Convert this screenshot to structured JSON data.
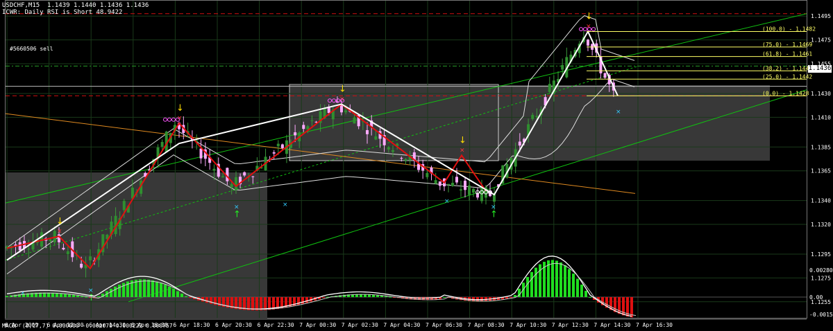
{
  "header": {
    "symbol_line": "USDCHF,M15  1.1439 1.1440 1.1436 1.1436",
    "indicator_line": "ICWR: Daily RSI is Short 48.9422",
    "order_label": "#5660506 sell",
    "current_price": "1.1436"
  },
  "macd": {
    "label": "MACD  (8,17,7) 0.000000 -0.001070 0.000222 0.000757"
  },
  "colors": {
    "background": "#000000",
    "grid": "#1a3a1a",
    "axis": "#ffffff",
    "wave_red": "#e01010",
    "wave_white": "#ffffff",
    "channel_green": "#10c010",
    "fib_yellow": "#ffff66",
    "resistance_red": "#d01010",
    "support_green": "#2aa02a",
    "bull_candle": "#2f8f2f",
    "bear_candle": "#ffaaff",
    "macd_pos": "#20dd20",
    "macd_neg": "#dd1010",
    "zone_fill": "#3a3a3a"
  },
  "chart_data": {
    "type": "candlestick",
    "symbol": "USDCHF",
    "timeframe": "M15",
    "ylim": [
      1.1245,
      1.1505
    ],
    "price_ticks": [
      "1.1495",
      "1.1475",
      "1.1455",
      "1.1430",
      "1.1410",
      "1.1385",
      "1.1365",
      "1.1340",
      "1.1320",
      "1.1295",
      "1.1275",
      "1.1255"
    ],
    "time_ticks": [
      "6 Apr 2009",
      "6 Apr 12:30",
      "6 Apr 14:30",
      "6 Apr 16:30",
      "6 Apr 18:30",
      "6 Apr 20:30",
      "6 Apr 22:30",
      "7 Apr 00:30",
      "7 Apr 02:30",
      "7 Apr 04:30",
      "7 Apr 06:30",
      "7 Apr 08:30",
      "7 Apr 10:30",
      "7 Apr 12:30",
      "7 Apr 14:30",
      "7 Apr 16:30"
    ],
    "fib_levels": [
      {
        "label": "(100.0) - 1.1482",
        "price": 1.1482
      },
      {
        "label": "(75.0) - 1.1469",
        "price": 1.1469
      },
      {
        "label": "(61.8) - 1.1461",
        "price": 1.1461
      },
      {
        "label": "(38.2) - 1.1449",
        "price": 1.1449
      },
      {
        "label": "(25.0) - 1.1442",
        "price": 1.1442
      },
      {
        "label": "(0.0) - 1.1428",
        "price": 1.1428
      }
    ],
    "swing_points": [
      {
        "time": "6 Apr 2009",
        "price": 1.13
      },
      {
        "time": "6 Apr 12:30",
        "price": 1.131
      },
      {
        "time": "6 Apr 14:30",
        "price": 1.1283
      },
      {
        "time": "6 Apr 18:30",
        "price": 1.1405
      },
      {
        "time": "6 Apr 20:30",
        "price": 1.1352
      },
      {
        "time": "7 Apr 02:30",
        "price": 1.1421
      },
      {
        "time": "7 Apr 06:30",
        "price": 1.1355
      },
      {
        "time": "7 Apr 08:30",
        "price": 1.1345
      },
      {
        "time": "7 Apr 12:30",
        "price": 1.1482
      },
      {
        "time": "7 Apr 14:30",
        "price": 1.1428
      }
    ],
    "macd_axis": [
      "0.002803",
      "0.00",
      "-0.00159"
    ],
    "macd_ylim": [
      -0.00159,
      0.002803
    ]
  }
}
